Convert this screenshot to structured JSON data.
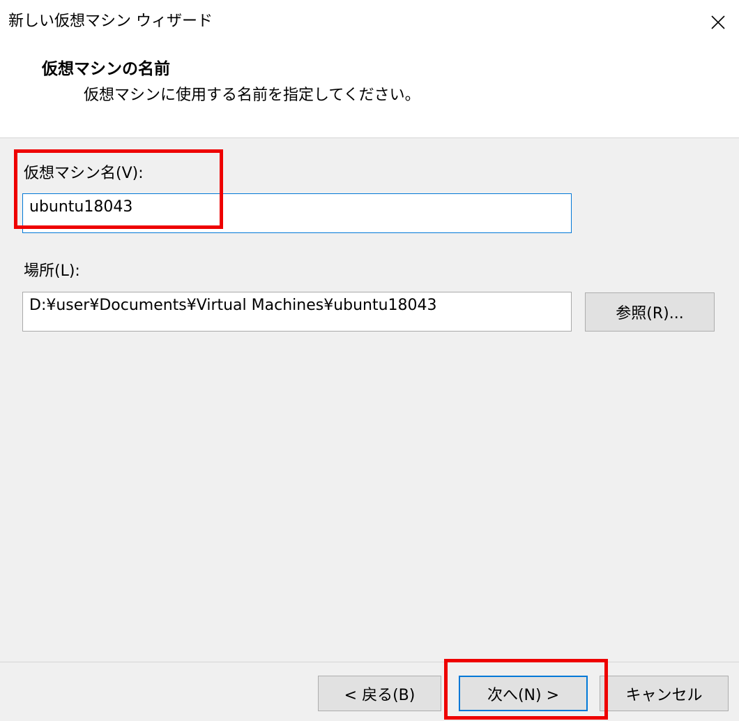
{
  "window": {
    "title": "新しい仮想マシン ウィザード",
    "close_icon": "close-icon"
  },
  "header": {
    "heading": "仮想マシンの名前",
    "subtitle": "仮想マシンに使用する名前を指定してください。"
  },
  "form": {
    "name_label": "仮想マシン名(V):",
    "name_value": "ubuntu18043",
    "location_label": "場所(L):",
    "location_value": "D:¥user¥Documents¥Virtual Machines¥ubuntu18043",
    "browse_label": "参照(R)..."
  },
  "footer": {
    "back_label": "< 戻る(B)",
    "next_label": "次へ(N) >",
    "cancel_label": "キャンセル"
  },
  "colors": {
    "highlight": "#ee0000",
    "focus_border": "#0078d7",
    "dialog_bg": "#f0f0f0"
  }
}
